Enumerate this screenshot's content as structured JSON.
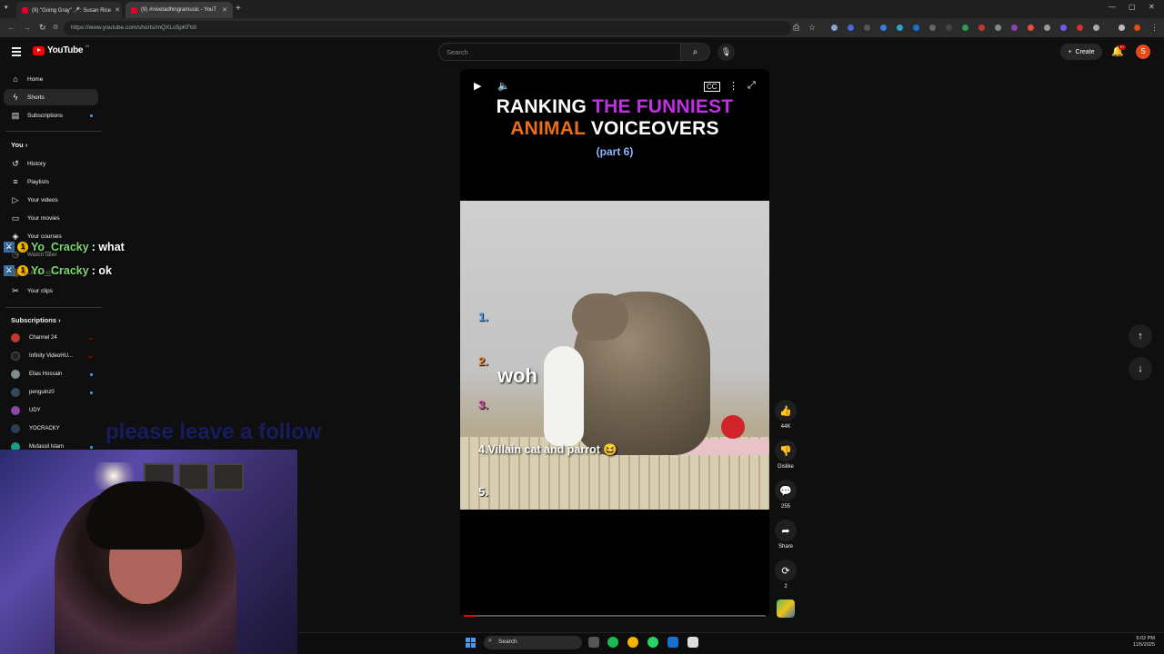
{
  "browser": {
    "tabs": [
      {
        "title": "(9) \"Going Gray\" 🎤: Susan Rice"
      },
      {
        "title": "(9) #nivetadhingramusic - YouT"
      }
    ],
    "url": "https://www.youtube.com/shorts/mQXLo5pKFb0"
  },
  "header": {
    "logo": "YouTube",
    "logo_country": "IN",
    "search_placeholder": "Search",
    "create_label": "Create",
    "notifications_count": "9+",
    "avatar_letter": "S"
  },
  "sidebar": {
    "main": [
      {
        "label": "Home",
        "icon": "home-icon"
      },
      {
        "label": "Shorts",
        "icon": "shorts-icon",
        "active": true
      },
      {
        "label": "Subscriptions",
        "icon": "subscriptions-icon"
      }
    ],
    "you_heading": "You",
    "you_items": [
      {
        "label": "History"
      },
      {
        "label": "Playlists"
      },
      {
        "label": "Your videos"
      },
      {
        "label": "Your movies"
      },
      {
        "label": "Your courses"
      },
      {
        "label": "Watch later"
      },
      {
        "label": "Liked videos"
      },
      {
        "label": "Your clips"
      }
    ],
    "subs_heading": "Subscriptions",
    "subscriptions": [
      {
        "name": "Channel 24",
        "color": "#c0392b",
        "status": "live"
      },
      {
        "name": "Infinity VideoHU...",
        "color": "#222222",
        "status": "live"
      },
      {
        "name": "Elias Hossain",
        "color": "#7f8c8d",
        "status": "dot"
      },
      {
        "name": "penguinz0",
        "color": "#34495e",
        "status": "dot"
      },
      {
        "name": "UDY",
        "color": "#8e44ad",
        "status": ""
      },
      {
        "name": "YOCRACKY",
        "color": "#2c3e50",
        "status": ""
      },
      {
        "name": "Mufassil Islam",
        "color": "#16a085",
        "status": "dot"
      }
    ]
  },
  "chat": [
    {
      "user": "Yo_Cracky",
      "badge": "1",
      "message": ": what"
    },
    {
      "user": "Yo_Cracky",
      "badge": "1",
      "message": ": ok"
    }
  ],
  "overlay_text": "please leave a follow",
  "short": {
    "title_line1_white": "RANKING",
    "title_line1_purple": "THE FUNNIEST",
    "title_line2_orange": "ANIMAL",
    "title_line2_white": "VOICEOVERS",
    "subtitle": "(part 6)",
    "ranks": [
      "1.",
      "2.",
      "3.",
      "4.",
      "5."
    ],
    "rank_colors": [
      "#4fa3ff",
      "#f08a2b",
      "#e040a0",
      "#ffffff",
      "#ffffff"
    ],
    "rank4_text": "Villain cat and parrot 😆",
    "caption": "woh",
    "progress": 0.04
  },
  "actions": {
    "likes": "44K",
    "dislike_label": "Dislike",
    "comments": "255",
    "share_label": "Share",
    "remix": "2"
  },
  "taskbar": {
    "search_label": "Search",
    "time": "6:02 PM",
    "date": "11/5/2025"
  }
}
